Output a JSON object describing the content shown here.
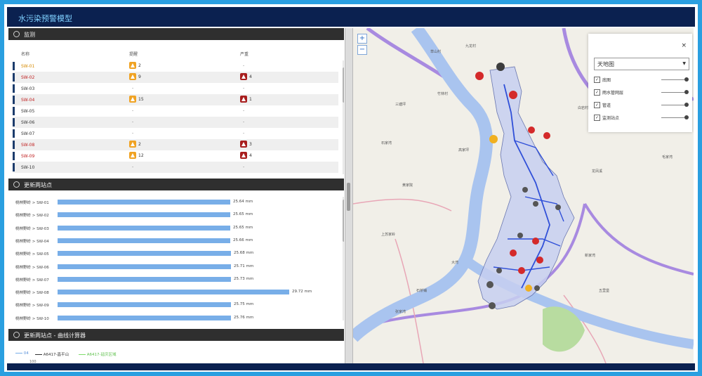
{
  "app": {
    "title": "水污染预警模型"
  },
  "panels": {
    "status": {
      "title": "监测",
      "columns": [
        "名称",
        "提醒",
        "严重"
      ],
      "rows": [
        {
          "name": "SW-01",
          "level": "warm",
          "warn": "2",
          "severe": "-"
        },
        {
          "name": "SW-02",
          "level": "hot",
          "warn": "9",
          "severe": "4"
        },
        {
          "name": "SW-03",
          "level": "none",
          "warn": "-",
          "severe": "-"
        },
        {
          "name": "SW-04",
          "level": "hot",
          "warn": "15",
          "severe": "1"
        },
        {
          "name": "SW-05",
          "level": "none",
          "warn": "-",
          "severe": "-"
        },
        {
          "name": "SW-06",
          "level": "none",
          "warn": "-",
          "severe": "-"
        },
        {
          "name": "SW-07",
          "level": "none",
          "warn": "-",
          "severe": "-"
        },
        {
          "name": "SW-08",
          "level": "hot",
          "warn": "2",
          "severe": "3"
        },
        {
          "name": "SW-09",
          "level": "hot",
          "warn": "12",
          "severe": "4"
        },
        {
          "name": "SW-10",
          "level": "none",
          "warn": "-",
          "severe": "-"
        }
      ]
    },
    "levels": {
      "title": "更新两站点",
      "unit": "mm",
      "rows": [
        {
          "label": "桃林野岭 > SW-01",
          "value": 25.64,
          "text": "25.64 mm"
        },
        {
          "label": "桃林野岭 > SW-02",
          "value": 25.65,
          "text": "25.65 mm"
        },
        {
          "label": "桃林野岭 > SW-03",
          "value": 25.65,
          "text": "25.65 mm"
        },
        {
          "label": "桃林野岭 > SW-04",
          "value": 25.66,
          "text": "25.66 mm"
        },
        {
          "label": "桃林野岭 > SW-05",
          "value": 25.68,
          "text": "25.68 mm"
        },
        {
          "label": "桃林野岭 > SW-06",
          "value": 25.71,
          "text": "25.71 mm"
        },
        {
          "label": "桃林野岭 > SW-07",
          "value": 25.73,
          "text": "25.73 mm"
        },
        {
          "label": "桃林野岭 > SW-08",
          "value": 29.72,
          "text": "29.72 mm"
        },
        {
          "label": "桃林野岭 > SW-09",
          "value": 25.75,
          "text": "25.75 mm"
        },
        {
          "label": "桃林野岭 > SW-10",
          "value": 25.76,
          "text": "25.76 mm"
        }
      ]
    },
    "trend": {
      "title": "更新两站点 - 曲线计算器",
      "legend": [
        {
          "label": "04",
          "color": "#78aee8"
        },
        {
          "label": "A6417-昌平山",
          "color": "#333333"
        },
        {
          "label": "A6417-延庆区域",
          "color": "#7fdc6a"
        }
      ],
      "axis_first": "100"
    }
  },
  "map": {
    "layer_select": "天地图",
    "close_icon": "×",
    "zoom_in": "+",
    "zoom_out": "−",
    "layers": [
      {
        "label": "底图",
        "checked": true,
        "opacity": 1.0
      },
      {
        "label": "雨水管网层",
        "checked": true,
        "opacity": 1.0
      },
      {
        "label": "管道",
        "checked": true,
        "opacity": 1.0
      },
      {
        "label": "监测站点",
        "checked": true,
        "opacity": 1.0
      }
    ],
    "labels": [
      "草山村",
      "九龙村",
      "三塘坪",
      "石家湾",
      "竹林村",
      "高家坪",
      "白岩村",
      "毛家湾",
      "上苏家岭",
      "黄家院",
      "石桥铺",
      "龙凤溪",
      "新家湾",
      "五里堡",
      "大湾",
      "张家湾"
    ]
  },
  "colors": {
    "title_bg": "#0b2150",
    "border": "#2a9fe0",
    "bar": "#78aee8",
    "severe": "#a81e1e",
    "warn": "#f0a324",
    "pipe": "#2f4fd8",
    "river": "#a9c4ef"
  }
}
